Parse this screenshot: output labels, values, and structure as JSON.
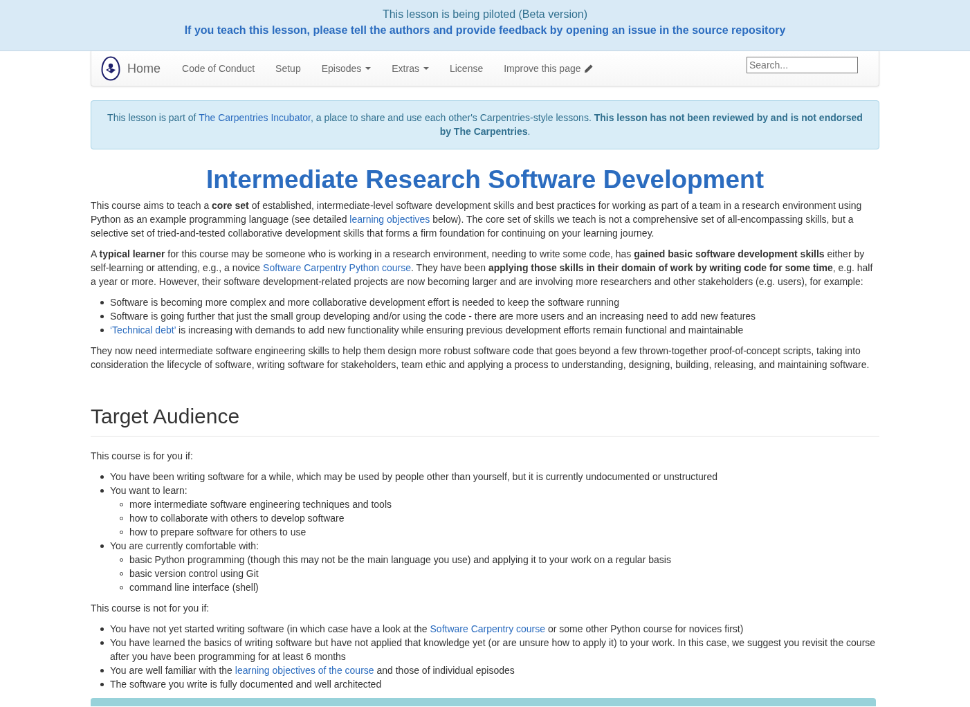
{
  "banner": {
    "title": "This lesson is being piloted (Beta version)",
    "link": "If you teach this lesson, please tell the authors and provide feedback by opening an issue in the source repository"
  },
  "navbar": {
    "brand": "Home",
    "items": [
      {
        "label": "Code of Conduct",
        "kind": "link"
      },
      {
        "label": "Setup",
        "kind": "link"
      },
      {
        "label": "Episodes",
        "kind": "dropdown"
      },
      {
        "label": "Extras",
        "kind": "dropdown"
      },
      {
        "label": "License",
        "kind": "link"
      },
      {
        "label": "Improve this page",
        "kind": "edit"
      }
    ],
    "search": {
      "placeholder": "Search..."
    }
  },
  "notice": [
    {
      "kind": "text",
      "text": "This lesson is part of "
    },
    {
      "kind": "link",
      "text": "The Carpentries Incubator"
    },
    {
      "kind": "text",
      "text": ", a place to share and use each other's Carpentries-style lessons. **This lesson has not been reviewed by and is not endorsed by The Carpentries**."
    }
  ],
  "title": "Intermediate Research Software Development",
  "content": [
    {
      "kind": "paragraph",
      "segments": [
        {
          "kind": "text",
          "text": "This course aims to teach a **core set** of established, intermediate-level software development skills and best practices for working as part of a team in a research environment using Python as an example programming language (see detailed "
        },
        {
          "kind": "link",
          "text": "learning objectives"
        },
        {
          "kind": "text",
          "text": " below). The core set of skills we teach is not a comprehensive set of all-encompassing skills, but a selective set of tried-and-tested collaborative development skills that forms a firm foundation for continuing on your learning journey."
        }
      ]
    },
    {
      "kind": "paragraph",
      "segments": [
        {
          "kind": "text",
          "text": "A **typical learner** for this course may be someone who is working in a research environment, needing to write some code, has **gained basic software development skills** either by self-learning or attending, e.g., a novice "
        },
        {
          "kind": "link",
          "text": "Software Carpentry Python course"
        },
        {
          "kind": "text",
          "text": ". They have been **applying those skills in their domain of work by writing code for some time**, e.g. half a year or more. However, their software development-related projects are now becoming larger and are involving more researchers and other stakeholders (e.g. users), for example:"
        }
      ]
    },
    {
      "kind": "list",
      "items": [
        {
          "segments": [
            {
              "kind": "text",
              "text": "Software is becoming more complex and more collaborative development effort is needed to keep the software running"
            }
          ]
        },
        {
          "segments": [
            {
              "kind": "text",
              "text": "Software is going further that just the small group developing and/or using the code - there are more users and an increasing need to add new features"
            }
          ]
        },
        {
          "segments": [
            {
              "kind": "link",
              "text": "‘Technical debt’"
            },
            {
              "kind": "text",
              "text": " is increasing with demands to add new functionality while ensuring previous development efforts remain functional and maintainable"
            }
          ]
        }
      ]
    },
    {
      "kind": "paragraph",
      "segments": [
        {
          "kind": "text",
          "text": "They now need intermediate software engineering skills to help them design more robust software code that goes beyond a few thrown-together proof-of-concept scripts, taking into consideration the lifecycle of software, writing software for stakeholders, team ethic and applying a process to understanding, designing, building, releasing, and maintaining software."
        }
      ]
    },
    {
      "kind": "heading",
      "text": "Target Audience"
    },
    {
      "kind": "paragraph",
      "segments": [
        {
          "kind": "text",
          "text": "This course is for you if:"
        }
      ]
    },
    {
      "kind": "list",
      "items": [
        {
          "segments": [
            {
              "kind": "text",
              "text": "You have been writing software for a while, which may be used by people other than yourself, but it is currently undocumented or unstructured"
            }
          ]
        },
        {
          "segments": [
            {
              "kind": "text",
              "text": "You want to learn:"
            }
          ],
          "children": [
            {
              "segments": [
                {
                  "kind": "text",
                  "text": "more intermediate software engineering techniques and tools"
                }
              ]
            },
            {
              "segments": [
                {
                  "kind": "text",
                  "text": "how to collaborate with others to develop software"
                }
              ]
            },
            {
              "segments": [
                {
                  "kind": "text",
                  "text": "how to prepare software for others to use"
                }
              ]
            }
          ]
        },
        {
          "segments": [
            {
              "kind": "text",
              "text": "You are currently comfortable with:"
            }
          ],
          "children": [
            {
              "segments": [
                {
                  "kind": "text",
                  "text": "basic Python programming (though this may not be the main language you use) and applying it to your work on a regular basis"
                }
              ]
            },
            {
              "segments": [
                {
                  "kind": "text",
                  "text": "basic version control using Git"
                }
              ]
            },
            {
              "segments": [
                {
                  "kind": "text",
                  "text": "command line interface (shell)"
                }
              ]
            }
          ]
        }
      ]
    },
    {
      "kind": "paragraph",
      "segments": [
        {
          "kind": "text",
          "text": "This course is not for you if:"
        }
      ]
    },
    {
      "kind": "list",
      "items": [
        {
          "segments": [
            {
              "kind": "text",
              "text": "You have not yet started writing software (in which case have a look at the "
            },
            {
              "kind": "link",
              "text": "Software Carpentry course"
            },
            {
              "kind": "text",
              "text": " or some other Python course for novices first)"
            }
          ]
        },
        {
          "segments": [
            {
              "kind": "text",
              "text": "You have learned the basics of writing software but have not applied that knowledge yet (or are unsure how to apply it) to your work. In this case, we suggest you revisit the course after you have been programming for at least 6 months"
            }
          ]
        },
        {
          "segments": [
            {
              "kind": "text",
              "text": "You are well familiar with the "
            },
            {
              "kind": "link",
              "text": "learning objectives of the course"
            },
            {
              "kind": "text",
              "text": " and those of individual episodes"
            }
          ]
        },
        {
          "segments": [
            {
              "kind": "text",
              "text": "The software you write is fully documented and well architected"
            }
          ]
        }
      ]
    },
    {
      "kind": "callout"
    }
  ]
}
